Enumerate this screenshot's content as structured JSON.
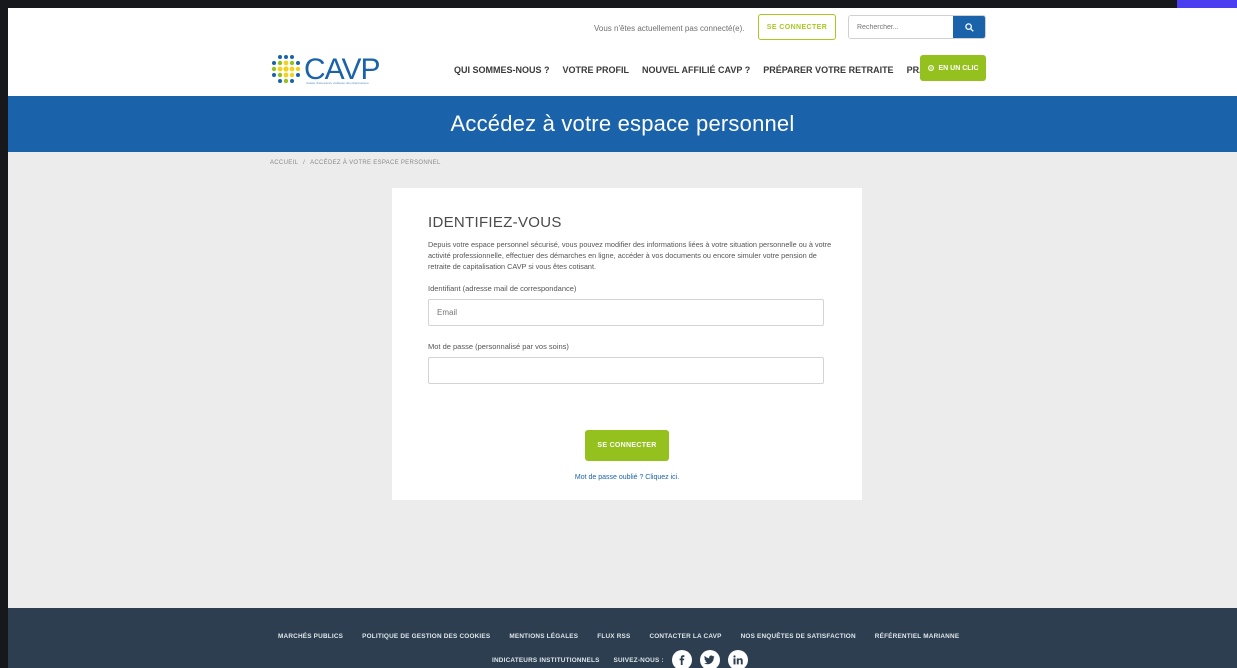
{
  "topbar": {
    "status_text": "Vous n'êtes actuellement pas connecté(e).",
    "login_label": "SE CONNECTER",
    "search_placeholder": "Rechercher..."
  },
  "logo": {
    "text": "CAVP",
    "subtitle": "Caisse d'assurance vieillesse des pharmaciens"
  },
  "nav": {
    "items": [
      {
        "label": "QUI SOMMES-NOUS ?"
      },
      {
        "label": "VOTRE PROFIL"
      },
      {
        "label": "NOUVEL AFFILIÉ CAVP ?"
      },
      {
        "label": "PRÉPARER VOTRE RETRAITE"
      },
      {
        "label": "PRATIQUE"
      }
    ],
    "cta_label": "EN UN CLIC"
  },
  "hero": {
    "title": "Accédez à votre espace personnel"
  },
  "breadcrumb": {
    "home": "ACCUEIL",
    "separator": "/",
    "current": "ACCÉDEZ À VOTRE ESPACE PERSONNEL"
  },
  "form": {
    "heading": "IDENTIFIEZ-VOUS",
    "intro": "Depuis votre espace personnel sécurisé, vous pouvez modifier des informations liées à votre situation personnelle ou à votre activité professionnelle, effectuer des démarches en ligne, accéder à vos documents ou encore simuler votre pension de retraite de capitalisation CAVP si vous êtes cotisant.",
    "id_label": "Identifiant (adresse mail de correspondance)",
    "id_placeholder": "Email",
    "id_value": "",
    "password_label": "Mot de passe (personnalisé par vos soins)",
    "password_value": "",
    "submit_label": "SE CONNECTER",
    "forgot_text": "Mot de passe oublié ? Cliquez ici."
  },
  "footer": {
    "links_row1": [
      {
        "label": "MARCHÉS PUBLICS"
      },
      {
        "label": "POLITIQUE DE GESTION DES COOKIES"
      },
      {
        "label": "MENTIONS LÉGALES"
      },
      {
        "label": "FLUX RSS"
      },
      {
        "label": "CONTACTER LA CAVP"
      },
      {
        "label": "NOS ENQUÊTES DE SATISFACTION"
      },
      {
        "label": "RÉFÉRENTIEL MARIANNE"
      }
    ],
    "indicators_label": "INDICATEURS INSTITUTIONNELS",
    "follow_label": "SUIVEZ-NOUS :",
    "social": [
      "facebook-icon",
      "twitter-icon",
      "linkedin-icon"
    ]
  },
  "colors": {
    "brand_blue": "#1a63ab",
    "brand_green": "#95c11f",
    "footer_bg": "#2c3e50"
  }
}
